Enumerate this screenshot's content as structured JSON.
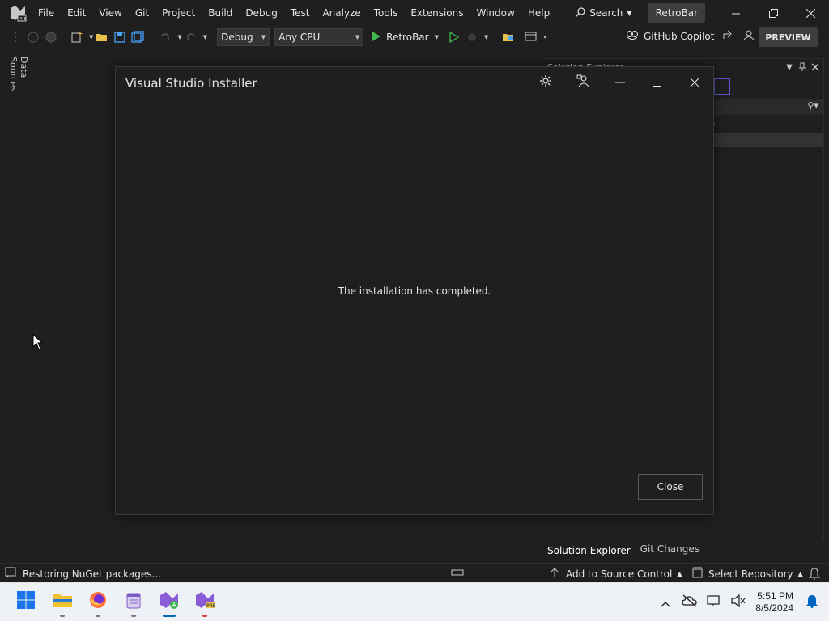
{
  "menubar": {
    "items": [
      "File",
      "Edit",
      "View",
      "Git",
      "Project",
      "Build",
      "Debug",
      "Test",
      "Analyze",
      "Tools",
      "Extensions",
      "Window",
      "Help"
    ],
    "search_label": "Search",
    "solution_name": "RetroBar"
  },
  "toolbar": {
    "config": "Debug",
    "platform": "Any CPU",
    "run_target": "RetroBar",
    "copilot_label": "GitHub Copilot",
    "preview_label": "PREVIEW"
  },
  "side_tab": {
    "label": "Data Sources"
  },
  "solution_explorer": {
    "title": "Solution Explorer",
    "paren": ")",
    "tabs": [
      "Solution Explorer",
      "Git Changes"
    ]
  },
  "dialog": {
    "title": "Visual Studio Installer",
    "message": "The installation has completed.",
    "close_label": "Close"
  },
  "statusbar": {
    "status": "Restoring NuGet packages...",
    "source_control": "Add to Source Control",
    "repository": "Select Repository"
  },
  "taskbar": {
    "time": "5:51 PM",
    "date": "8/5/2024"
  },
  "colors": {
    "background": "#1f1f1f",
    "run_green": "#3fb950",
    "vs_purple": "#8a5cd6",
    "accent_blue": "#0067c0"
  }
}
